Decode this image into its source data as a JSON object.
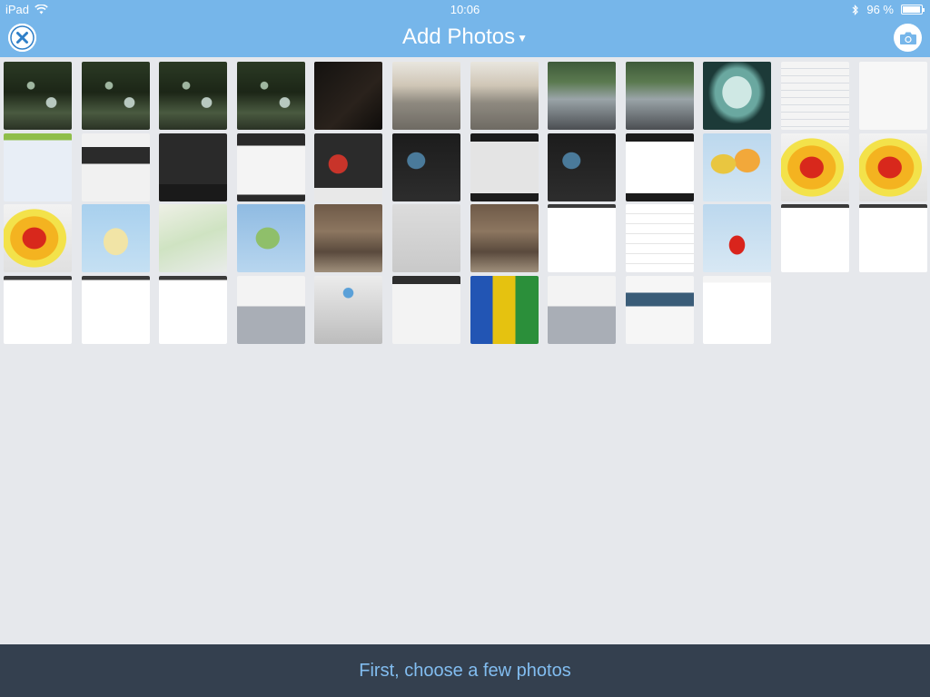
{
  "status_bar": {
    "device": "iPad",
    "time": "10:06",
    "battery_percent": "96 %",
    "battery_level": 0.96,
    "icons": [
      "wifi-icon",
      "bluetooth-icon",
      "battery-icon"
    ]
  },
  "nav": {
    "title": "Add Photos",
    "close_icon": "close-icon",
    "camera_icon": "camera-icon"
  },
  "footer": {
    "message": "First, choose a few photos"
  },
  "colors": {
    "accent": "#76b6ea",
    "footer_bg": "#34404f",
    "footer_text": "#82bdf0",
    "background": "#e6e8ec"
  },
  "photos": [
    {
      "kind": "tree"
    },
    {
      "kind": "tree"
    },
    {
      "kind": "tree"
    },
    {
      "kind": "tree"
    },
    {
      "kind": "dark"
    },
    {
      "kind": "patio"
    },
    {
      "kind": "patio"
    },
    {
      "kind": "table"
    },
    {
      "kind": "table"
    },
    {
      "kind": "face"
    },
    {
      "kind": "list"
    },
    {
      "kind": "blank"
    },
    {
      "kind": "europe-map"
    },
    {
      "kind": "app-white"
    },
    {
      "kind": "dark-screen"
    },
    {
      "kind": "chart-screen"
    },
    {
      "kind": "red-question"
    },
    {
      "kind": "dark-slide"
    },
    {
      "kind": "dark-app"
    },
    {
      "kind": "dark-slide"
    },
    {
      "kind": "draw-screen"
    },
    {
      "kind": "world-map"
    },
    {
      "kind": "asia-heat"
    },
    {
      "kind": "asia-heat"
    },
    {
      "kind": "asia-heat"
    },
    {
      "kind": "indonesia-map"
    },
    {
      "kind": "road-map"
    },
    {
      "kind": "sumatra-map"
    },
    {
      "kind": "disaster"
    },
    {
      "kind": "grey-map"
    },
    {
      "kind": "disaster"
    },
    {
      "kind": "text-doc"
    },
    {
      "kind": "settings-screen"
    },
    {
      "kind": "indonesia-red"
    },
    {
      "kind": "text-doc"
    },
    {
      "kind": "text-doc"
    },
    {
      "kind": "menu-screen"
    },
    {
      "kind": "menu-screen"
    },
    {
      "kind": "menu-screen"
    },
    {
      "kind": "keyboard"
    },
    {
      "kind": "grey-plus"
    },
    {
      "kind": "gallery-screen"
    },
    {
      "kind": "colorful-grid"
    },
    {
      "kind": "keyboard-apple"
    },
    {
      "kind": "photo-strip"
    },
    {
      "kind": "light-screen"
    }
  ]
}
